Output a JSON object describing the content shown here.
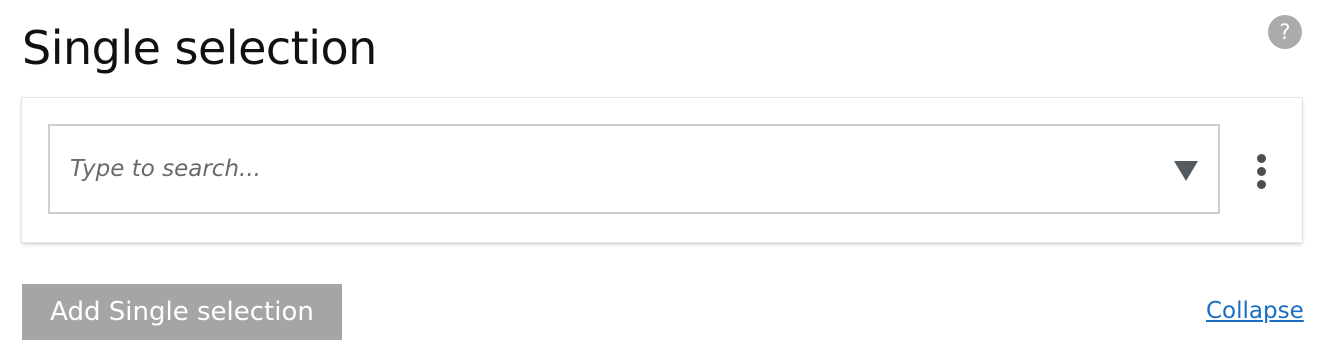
{
  "header": {
    "title": "Single selection",
    "help_label": "?"
  },
  "field": {
    "search_placeholder": "Type to search...",
    "search_value": ""
  },
  "actions": {
    "add_label": "Add Single selection",
    "collapse_label": "Collapse"
  },
  "icons": {
    "help": "question-circle-icon",
    "dropdown": "triangle-down-icon",
    "menu": "kebab-vertical-icon"
  },
  "colors": {
    "link": "#1a6ec2",
    "button_disabled": "#a5a5a5",
    "help_badge": "#ababab"
  }
}
